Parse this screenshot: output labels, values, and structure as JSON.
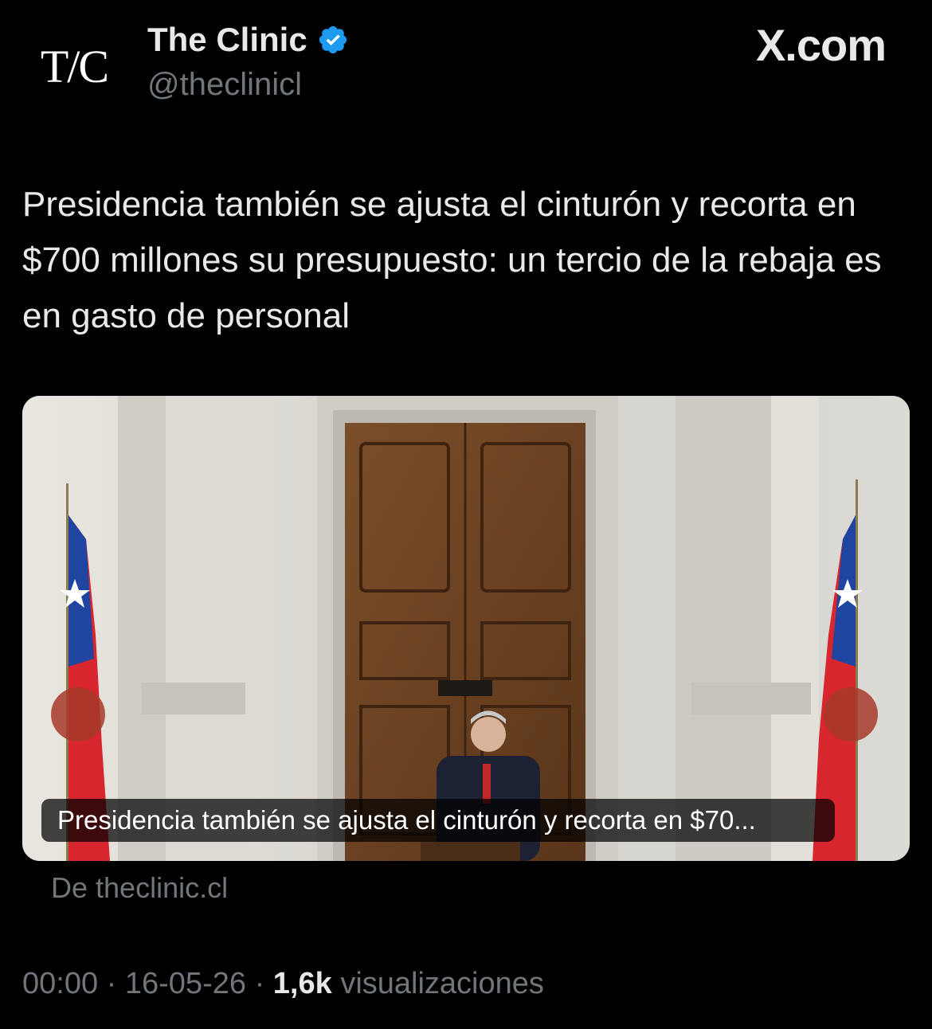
{
  "author": {
    "avatar_text": "T/C",
    "display_name": "The Clinic",
    "handle": "@theclinicl"
  },
  "site_brand": "X.com",
  "tweet": {
    "text": "Presidencia también se ajusta el cinturón y recorta en $700 millones su presupuesto: un tercio de la rebaja es en gasto de personal"
  },
  "card": {
    "caption": "Presidencia también se ajusta el cinturón y recorta en $70...",
    "source": "De theclinic.cl"
  },
  "meta": {
    "time": "00:00",
    "separator": "·",
    "date": "16-05-26",
    "views_count": "1,6k",
    "views_label": "visualizaciones"
  },
  "colors": {
    "background": "#000000",
    "text": "#e7e9ea",
    "secondary_text": "#71767b",
    "verified_badge": "#1d9bf0"
  }
}
